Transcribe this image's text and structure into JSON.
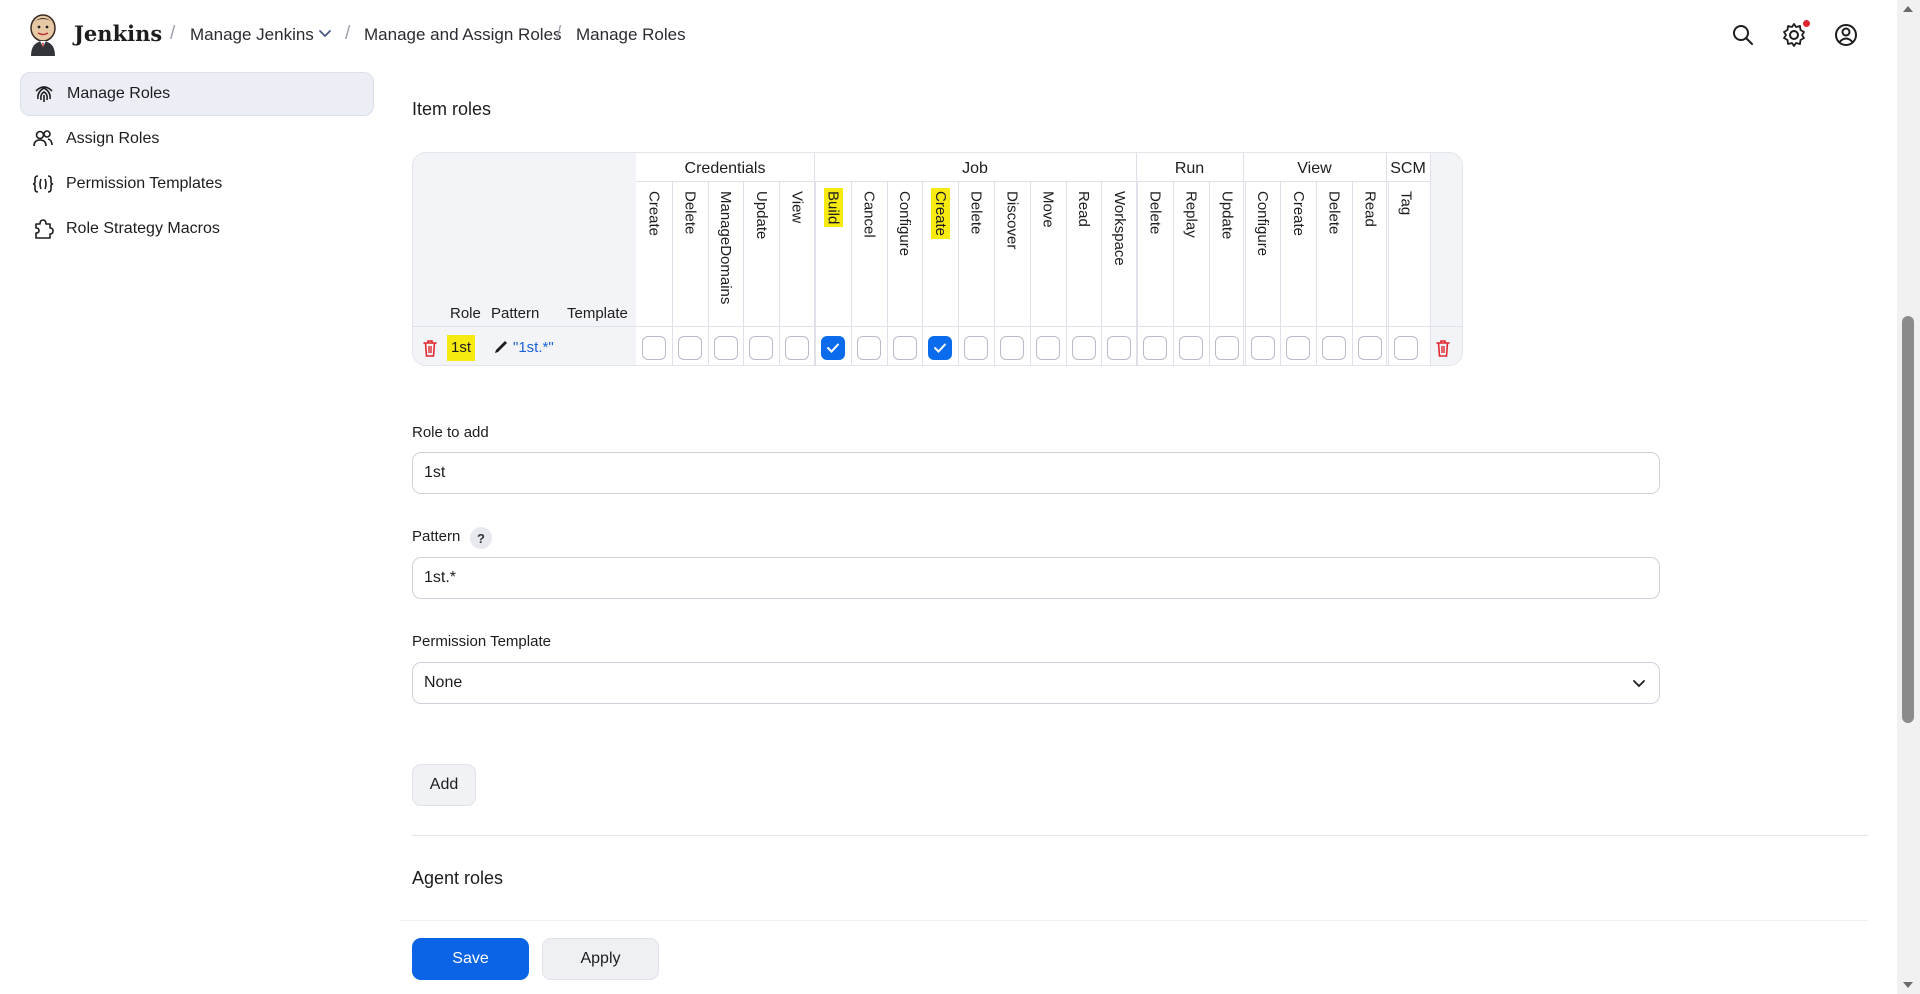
{
  "header": {
    "brand": "Jenkins",
    "breadcrumbs": [
      "Manage Jenkins",
      "Manage and Assign Roles",
      "Manage Roles"
    ],
    "icons": [
      "search-icon",
      "settings-icon",
      "user-icon"
    ]
  },
  "sidebar": {
    "items": [
      {
        "label": "Manage Roles",
        "icon": "fingerprint-icon",
        "active": true
      },
      {
        "label": "Assign Roles",
        "icon": "users-icon",
        "active": false
      },
      {
        "label": "Permission Templates",
        "icon": "braces-icon",
        "active": false
      },
      {
        "label": "Role Strategy Macros",
        "icon": "puzzle-icon",
        "active": false
      }
    ]
  },
  "item_roles": {
    "title": "Item roles",
    "groups": [
      "Credentials",
      "Job",
      "Run",
      "View",
      "SCM"
    ],
    "columns": {
      "role": "Role",
      "pattern": "Pattern",
      "template": "Template"
    },
    "permissions": [
      "Create",
      "Delete",
      "ManageDomains",
      "Update",
      "View",
      "Build",
      "Cancel",
      "Configure",
      "Create",
      "Delete",
      "Discover",
      "Move",
      "Read",
      "Workspace",
      "Delete",
      "Replay",
      "Update",
      "Configure",
      "Create",
      "Delete",
      "Read",
      "Tag"
    ],
    "row": {
      "role": "1st",
      "pattern": "\"1st.*\"",
      "checked": [
        false,
        false,
        false,
        false,
        false,
        true,
        false,
        false,
        true,
        false,
        false,
        false,
        false,
        false,
        false,
        false,
        false,
        false,
        false,
        false,
        false,
        false
      ]
    }
  },
  "form": {
    "role_label": "Role to add",
    "role_value": "1st",
    "pattern_label": "Pattern",
    "pattern_help": "?",
    "pattern_value": "1st.*",
    "template_label": "Permission Template",
    "template_value": "None",
    "add_label": "Add"
  },
  "agent_roles": {
    "title": "Agent roles"
  },
  "footer": {
    "save_label": "Save",
    "apply_label": "Apply"
  },
  "colors": {
    "accent": "#0b63e5",
    "highlight": "#f7ea10",
    "danger": "#e0262e"
  }
}
